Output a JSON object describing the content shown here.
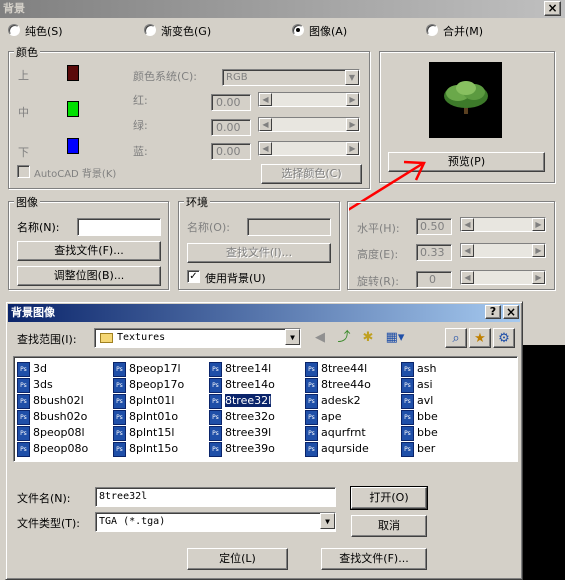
{
  "bg_dialog": {
    "title": "背景",
    "close_glyph": "×",
    "types": [
      {
        "label": "纯色(S)",
        "selected": false
      },
      {
        "label": "渐变色(G)",
        "selected": false
      },
      {
        "label": "图像(A)",
        "selected": true
      },
      {
        "label": "合并(M)",
        "selected": false
      }
    ],
    "colors_group": {
      "label": "颜色",
      "top": "上",
      "middle": "中",
      "bottom": "下",
      "swatch_top": "#5a0a0a",
      "swatch_middle": "#00e000",
      "swatch_bottom": "#0000ff",
      "system_label": "颜色系统(C):",
      "system_value": "RGB",
      "red": "红:",
      "green": "绿:",
      "blue": "蓝:",
      "red_value": "0.00",
      "green_value": "0.00",
      "blue_value": "0.00",
      "autocad_bg": "AutoCAD 背景(K)",
      "select_color": "选择颜色(C)"
    },
    "preview_button": "预览(P)",
    "image_group": {
      "label": "图像",
      "name_label": "名称(N):",
      "name_value": "",
      "find_file": "查找文件(F)...",
      "adjust_bitmap": "调整位图(B)..."
    },
    "env_group": {
      "label": "环境",
      "name_label": "名称(O):",
      "find_file": "查找文件(I)...",
      "use_background": "使用背景(U)",
      "use_background_checked": true
    },
    "sliders": {
      "horizontal": "水平(H):",
      "horizontal_value": "0.50",
      "height": "高度(E):",
      "height_value": "0.33",
      "rotate": "旋转(R):",
      "rotate_value": "0"
    }
  },
  "file_dialog": {
    "title": "背景图像",
    "help_glyph": "?",
    "close_glyph": "×",
    "look_in_label": "查找范围(I):",
    "look_in_value": "Textures",
    "columns": [
      [
        "3d",
        "3ds",
        "8bush02l",
        "8bush02o",
        "8peop08l",
        "8peop08o"
      ],
      [
        "8peop17l",
        "8peop17o",
        "8plnt01l",
        "8plnt01o",
        "8plnt15l",
        "8plnt15o"
      ],
      [
        "8tree14l",
        "8tree14o",
        "8tree32l",
        "8tree32o",
        "8tree39l",
        "8tree39o"
      ],
      [
        "8tree44l",
        "8tree44o",
        "adesk2",
        "ape",
        "aqurfrnt",
        "aqurside"
      ],
      [
        "ash",
        "asi",
        "avl",
        "bbe",
        "bbe",
        "ber"
      ]
    ],
    "selected_file": "8tree32l",
    "filename_label": "文件名(N):",
    "filename_value": "8tree32l",
    "filetype_label": "文件类型(T):",
    "filetype_value": "TGA (*.tga)",
    "open_button": "打开(O)",
    "cancel_button": "取消",
    "locate_button": "定位(L)",
    "find_file_button": "查找文件(F)..."
  }
}
